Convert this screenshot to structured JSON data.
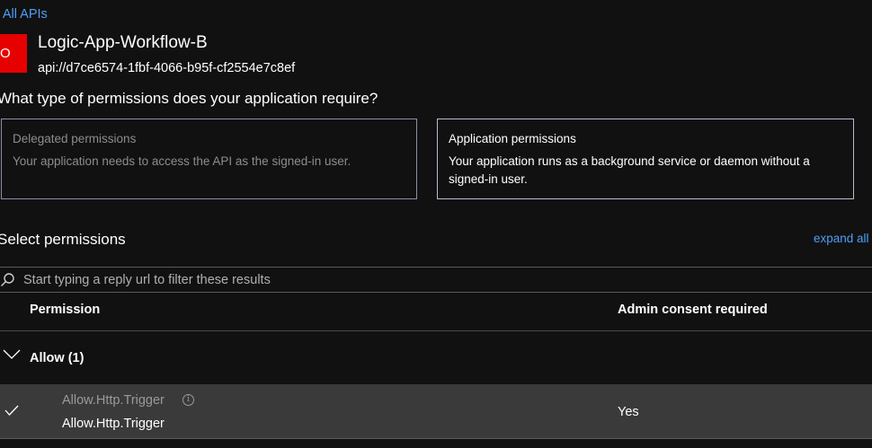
{
  "nav": {
    "back_label": "All APIs",
    "back_chevron": "‹"
  },
  "api": {
    "avatar_text": "O",
    "name": "Logic-App-Workflow-B",
    "uri": "api://d7ce6574-1fbf-4066-b95f-cf2554e7c8ef"
  },
  "question": "What type of permissions does your application require?",
  "permission_types": {
    "delegated": {
      "title": "Delegated permissions",
      "description": "Your application needs to access the API as the signed-in user.",
      "selected": false
    },
    "application": {
      "title": "Application permissions",
      "description": "Your application runs as a background service or daemon without a signed-in user.",
      "selected": true
    }
  },
  "select_permissions": {
    "title": "Select permissions",
    "expand_label": "expand all",
    "filter_placeholder": "Start typing a reply url to filter these results",
    "columns": {
      "permission": "Permission",
      "admin_consent": "Admin consent required"
    },
    "groups": [
      {
        "label": "Allow (1)",
        "expanded": true,
        "items": [
          {
            "name": "Allow.Http.Trigger",
            "description": "Allow.Http.Trigger",
            "admin_consent": "Yes",
            "checked": true
          }
        ]
      }
    ]
  },
  "colors": {
    "background": "#111111",
    "link": "#4f9ef8",
    "avatar": "#e60000",
    "selected_row": "#3a3a3a"
  }
}
